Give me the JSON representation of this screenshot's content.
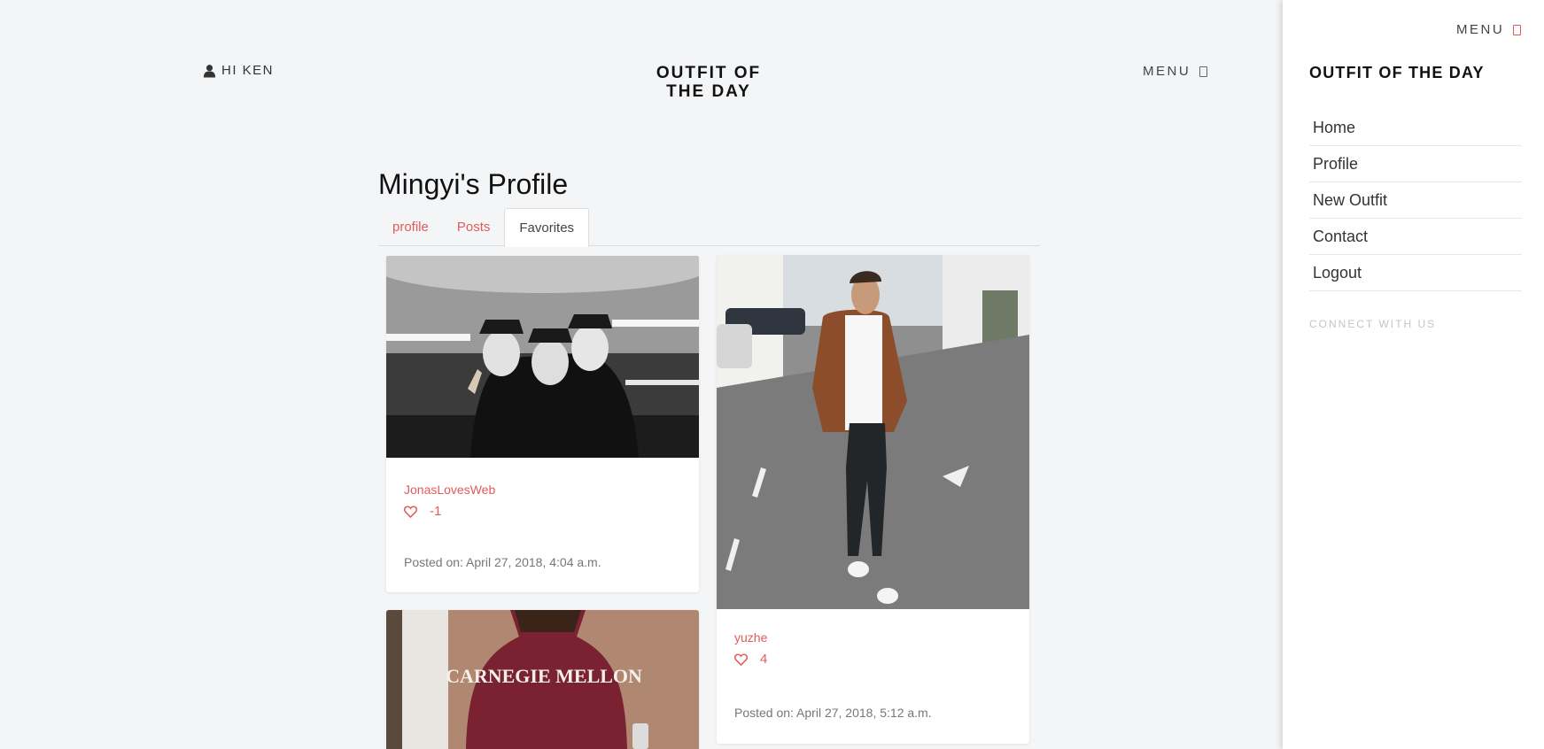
{
  "header": {
    "user_greeting": "HI KEN",
    "brand_line1": "OUTFIT OF",
    "brand_line2": "THE DAY",
    "menu_label": "MENU"
  },
  "profile": {
    "title": "Mingyi's Profile",
    "tabs": [
      {
        "label": "profile",
        "active": false
      },
      {
        "label": "Posts",
        "active": false
      },
      {
        "label": "Favorites",
        "active": true
      }
    ]
  },
  "posts": [
    {
      "author": "JonasLovesWeb",
      "likes": "-1",
      "posted": "Posted on: April 27, 2018, 4:04 a.m.",
      "image": "three people in white masks and black bucket hats"
    },
    {
      "author": "yuzhe",
      "likes": "4",
      "posted": "Posted on: April 27, 2018, 5:12 a.m.",
      "image": "man in brown suede jacket walking on street"
    },
    {
      "author": "",
      "likes": "",
      "posted": "",
      "image": "person in maroon Carnegie Mellon sweatshirt"
    }
  ],
  "sweatshirt_text": "CARNEGIE MELLON",
  "side_panel": {
    "menu_label": "MENU",
    "brand": "OUTFIT OF THE DAY",
    "nav": [
      "Home",
      "Profile",
      "New Outfit",
      "Contact",
      "Logout"
    ],
    "connect_label": "CONNECT WITH US"
  },
  "colors": {
    "accent": "#e25b5b",
    "background": "#f4f5f7"
  }
}
